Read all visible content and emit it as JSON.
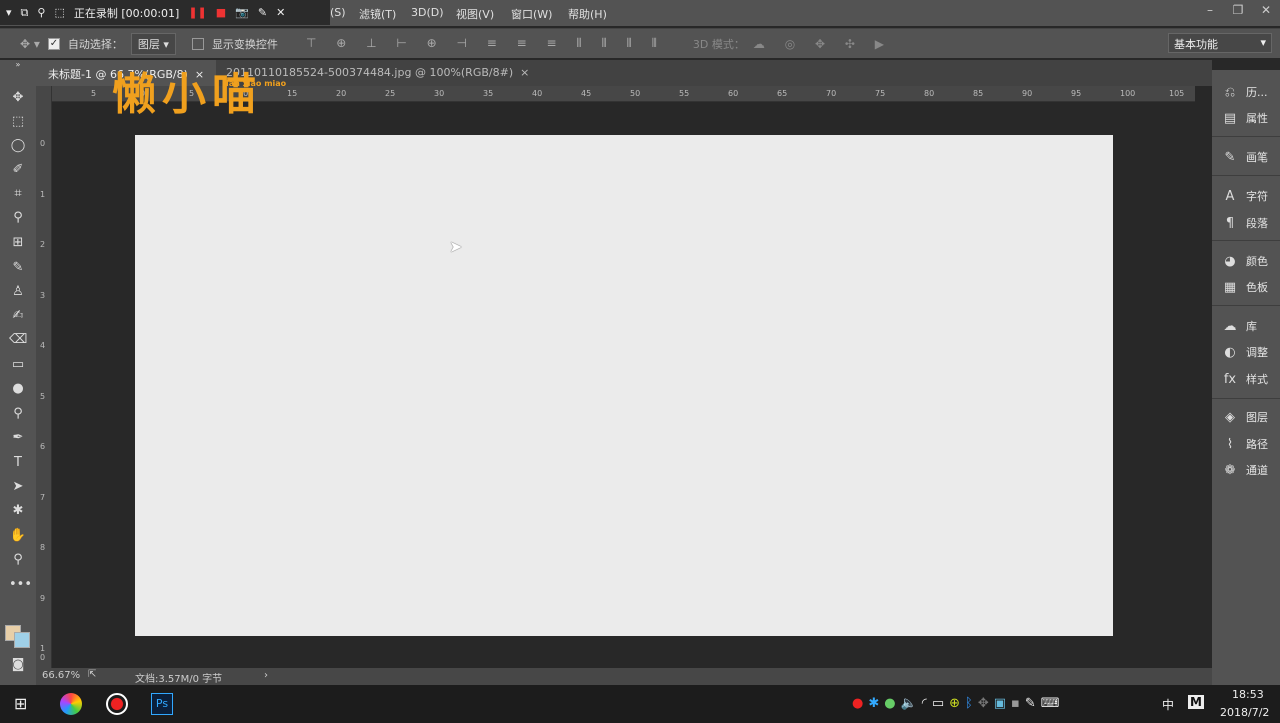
{
  "recorder": {
    "status": "正在录制 [00:00:01]"
  },
  "menu": [
    "(S)",
    "滤镜(T)",
    "3D(D)",
    "视图(V)",
    "窗口(W)",
    "帮助(H)"
  ],
  "options": {
    "auto_select_label": "自动选择：",
    "auto_select_checked": true,
    "auto_select_value": "图层",
    "show_transform_label": "显示变换控件",
    "show_transform_checked": false,
    "mode_3d_label": "3D 模式：",
    "workspace": "基本功能"
  },
  "tabs": [
    {
      "label": "未标题-1 @ 66.7%(RGB/8)",
      "active": true
    },
    {
      "label": "20110110185524-500374484.jpg @ 100%(RGB/8#)",
      "active": false
    }
  ],
  "watermark": {
    "text": "懒小喵",
    "pinyin": "lan xiao miao"
  },
  "ruler_top": [
    "5",
    "0",
    "5",
    "10",
    "15",
    "20",
    "25",
    "30",
    "35",
    "40",
    "45",
    "50",
    "55",
    "60",
    "65",
    "70",
    "75",
    "80",
    "85",
    "90",
    "95",
    "100",
    "105"
  ],
  "ruler_left": [
    "0",
    "1",
    "2",
    "3",
    "4",
    "5",
    "6",
    "7",
    "8",
    "9",
    "10"
  ],
  "status": {
    "zoom": "66.67%",
    "doc": "文档:3.57M/0 字节"
  },
  "panels": [
    {
      "icon": "history-icon",
      "glyph": "⎌",
      "label": "历..."
    },
    {
      "icon": "properties-icon",
      "glyph": "▤",
      "label": "属性"
    },
    {
      "icon": "brush-icon",
      "glyph": "✎",
      "label": "画笔"
    },
    {
      "icon": "character-icon",
      "glyph": "A",
      "label": "字符"
    },
    {
      "icon": "paragraph-icon",
      "glyph": "¶",
      "label": "段落"
    },
    {
      "icon": "color-icon",
      "glyph": "◕",
      "label": "颜色"
    },
    {
      "icon": "swatches-icon",
      "glyph": "▦",
      "label": "色板"
    },
    {
      "icon": "libraries-icon",
      "glyph": "☁",
      "label": "库"
    },
    {
      "icon": "adjustments-icon",
      "glyph": "◐",
      "label": "调整"
    },
    {
      "icon": "styles-icon",
      "glyph": "fx",
      "label": "样式"
    },
    {
      "icon": "layers-icon",
      "glyph": "◈",
      "label": "图层"
    },
    {
      "icon": "paths-icon",
      "glyph": "⌇",
      "label": "路径"
    },
    {
      "icon": "channels-icon",
      "glyph": "❁",
      "label": "通道"
    }
  ],
  "taskbar": {
    "time": "18:53",
    "date": "2018/7/2",
    "ime": "中",
    "ime2": "M"
  }
}
